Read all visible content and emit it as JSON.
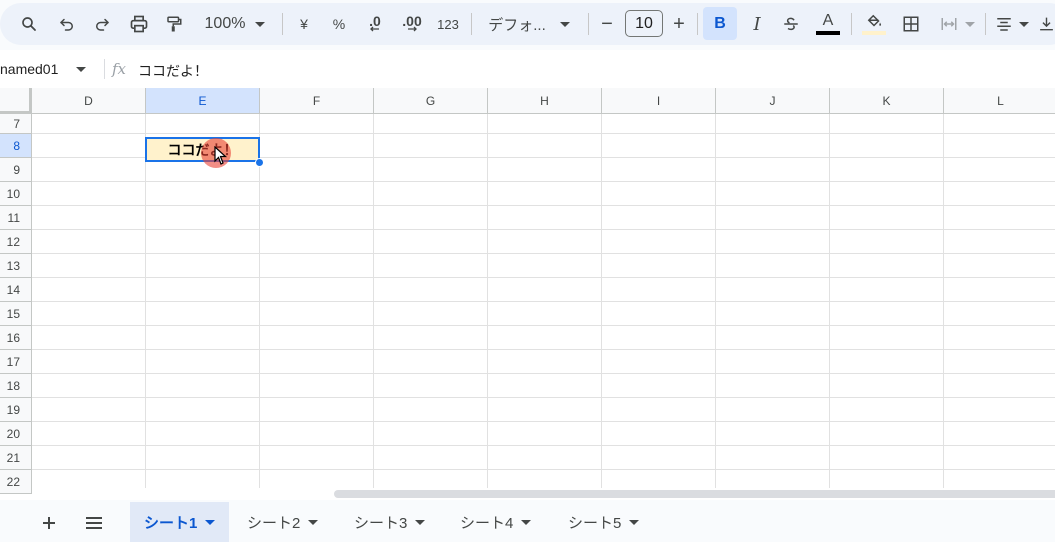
{
  "toolbar": {
    "zoom": "100%",
    "currency": "¥",
    "percent": "%",
    "dec_decrease": ".0",
    "dec_increase": ".00",
    "number_format": "123",
    "font": "デフォ...",
    "font_size": "10",
    "minus": "−",
    "plus": "+",
    "bold": "B",
    "italic": "I",
    "text_color_letter": "A"
  },
  "formula_bar": {
    "name_box": "named01",
    "fx": "fx",
    "content": "ココだよ！"
  },
  "grid": {
    "columns": [
      "D",
      "E",
      "F",
      "G",
      "H",
      "I",
      "J",
      "K",
      "L"
    ],
    "selected_column": "E",
    "rows": [
      "7",
      "8",
      "9",
      "10",
      "11",
      "12",
      "13",
      "14",
      "15",
      "16",
      "17",
      "18",
      "19",
      "20",
      "21",
      "22"
    ],
    "selected_row": "8",
    "active_cell_text": "ココだよ！",
    "active_cell_fill": "#fff2cc",
    "selection_color": "#1a73e8"
  },
  "sheets": {
    "tabs": [
      {
        "label": "シート1",
        "active": true
      },
      {
        "label": "シート2",
        "active": false
      },
      {
        "label": "シート3",
        "active": false
      },
      {
        "label": "シート4",
        "active": false
      },
      {
        "label": "シート5",
        "active": false
      }
    ]
  }
}
